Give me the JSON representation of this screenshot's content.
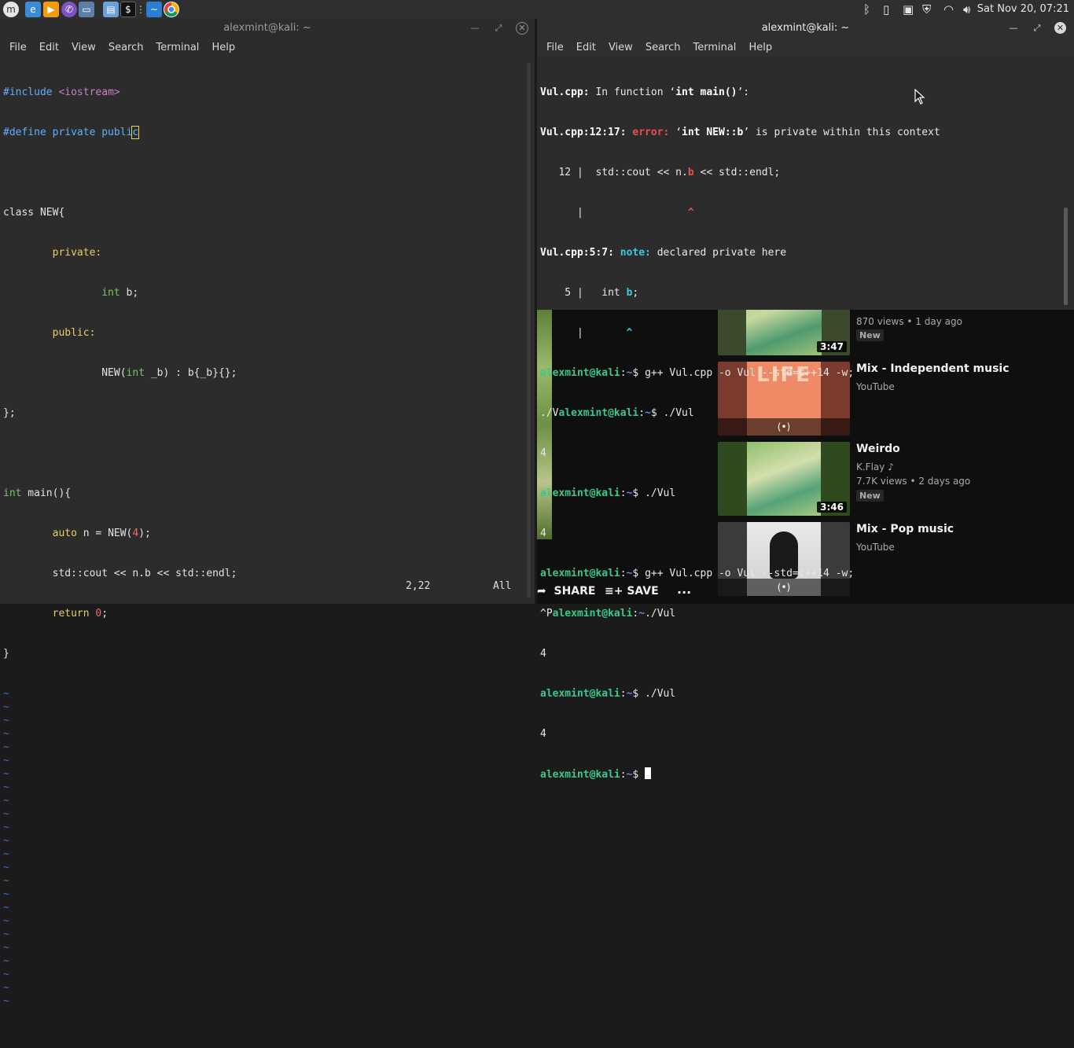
{
  "panel": {
    "clock": "Sat Nov 20, 07:21"
  },
  "vim_window": {
    "title": "alexmint@kali: ~",
    "menu": [
      "File",
      "Edit",
      "View",
      "Search",
      "Terminal",
      "Help"
    ],
    "code": {
      "l1_a": "#include ",
      "l1_b": "<iostream>",
      "l2_a": "#define private publi",
      "l2_b": "c",
      "l4_a": "class NEW{",
      "l5_a": "        private:",
      "l6_a": "                ",
      "l6_b": "int",
      "l6_c": " b;",
      "l7_a": "        public:",
      "l8_a": "                NEW(",
      "l8_b": "int",
      "l8_c": " _b) : b{_b}{};",
      "l9_a": "};",
      "l11_a": "int",
      "l11_b": " main(){",
      "l12_a": "        ",
      "l12_b": "auto",
      "l12_c": " n = NEW(",
      "l12_d": "4",
      "l12_e": ");",
      "l13_a": "        std::cout << n.b << std::endl;",
      "l14_a": "        ",
      "l14_b": "return",
      "l14_c": " ",
      "l14_d": "0",
      "l14_e": ";",
      "l15_a": "}"
    },
    "tilde": "~",
    "status_pos": "2,22",
    "status_all": "All"
  },
  "term_window": {
    "title": "alexmint@kali: ~",
    "menu": [
      "File",
      "Edit",
      "View",
      "Search",
      "Terminal",
      "Help"
    ],
    "out": {
      "r1_a": "Vul.cpp:",
      "r1_b": " In function ‘",
      "r1_c": "int main()",
      "r1_d": "’:",
      "r2_a": "Vul.cpp:12:17:",
      "r2_b": " error:",
      "r2_c": " ‘",
      "r2_d": "int NEW::b",
      "r2_e": "’ is private within this context",
      "r3_a": "   12 |  std::cout << n.",
      "r3_b": "b",
      "r3_c": " << std::endl;",
      "r4_a": "      |                 ",
      "r4_b": "^",
      "r5_a": "Vul.cpp:5:7:",
      "r5_b": " note:",
      "r5_c": " declared private here",
      "r6_a": "    5 |   int ",
      "r6_b": "b",
      "r6_c": ";",
      "r7_a": "      |       ",
      "r7_b": "^",
      "user": "alexmint@kali",
      "colon": ":",
      "tilde": "~",
      "dollar": "$ ",
      "r8_cmd": "g++ Vul.cpp -o Vul --std=c++14 -w;",
      "r9_a": "./V",
      "r9_cmd": "./Vul",
      "four": "4",
      "r12_cmd": "g++ Vul.cpp -o Vul --std=c++14 -w;",
      "r13_a": "^P",
      "r13_cmd": "./Vul",
      "r15_cmd": "./Vul"
    }
  },
  "youtube": {
    "v1_meta": "870 views • 1 day ago",
    "v1_badge": "New",
    "v1_dur": "3:47",
    "v2_title": "Mix - Independent music",
    "v2_channel": "YouTube",
    "v2_thumb_text": "LIFE",
    "v3_title": "Weirdo",
    "v3_channel": "K.Flay",
    "v3_meta": "7.7K views • 2 days ago",
    "v3_badge": "New",
    "v3_dur": "3:46",
    "v4_title": "Mix - Pop music",
    "v4_channel": "YouTube",
    "live_icon": "(•)",
    "share_label": "SHARE",
    "save_label": "SAVE",
    "more_label": "..."
  }
}
